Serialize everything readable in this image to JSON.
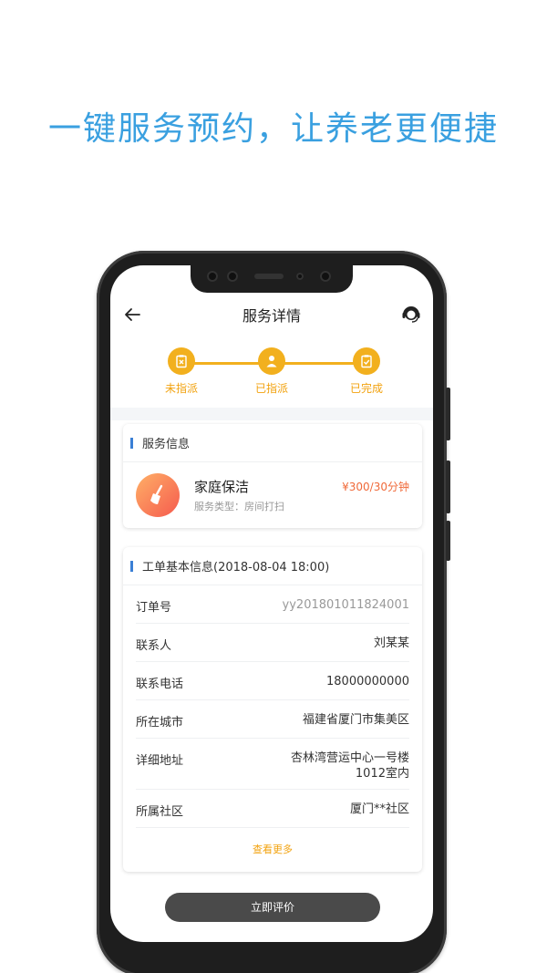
{
  "promo": {
    "headline": "一键服务预约，让养老更便捷"
  },
  "header": {
    "title": "服务详情"
  },
  "steps": [
    {
      "label": "未指派"
    },
    {
      "label": "已指派"
    },
    {
      "label": "已完成"
    }
  ],
  "service_card": {
    "heading": "服务信息",
    "name": "家庭保洁",
    "type": "服务类型：房间打扫",
    "price": "¥300/30分钟"
  },
  "order_card": {
    "heading": "工单基本信息(2018-08-04 18:00)",
    "rows": [
      {
        "key": "订单号",
        "value": "yy201801011824001"
      },
      {
        "key": "联系人",
        "value": "刘某某"
      },
      {
        "key": "联系电话",
        "value": "18000000000"
      },
      {
        "key": "所在城市",
        "value": "福建省厦门市集美区"
      },
      {
        "key": "详细地址",
        "value": "杏林湾营运中心一号楼",
        "value2": "1012室内"
      },
      {
        "key": "所属社区",
        "value": "厦门**社区"
      }
    ],
    "more": "查看更多"
  },
  "action": {
    "label": "立即评价"
  },
  "colors": {
    "accent": "#f2b01e",
    "promo": "#3aa0e0",
    "price": "#f06a3a"
  }
}
